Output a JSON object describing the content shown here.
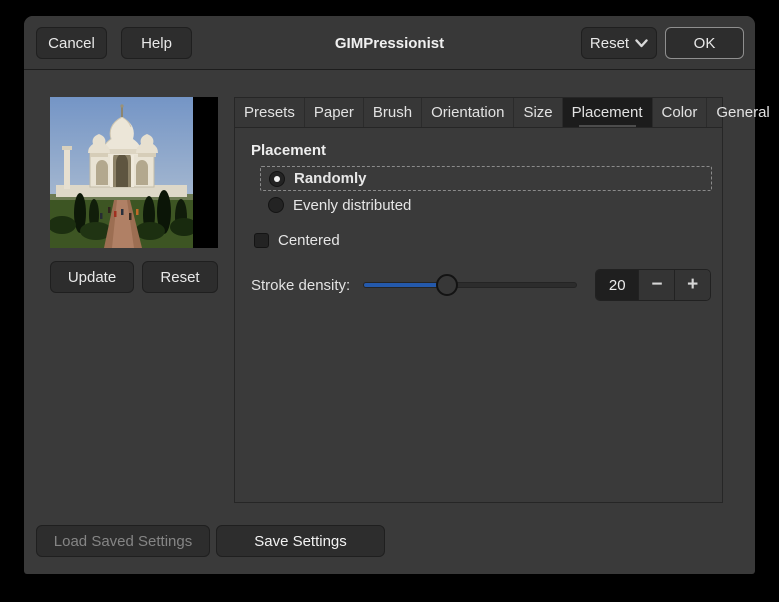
{
  "window": {
    "title": "GIMPressionist"
  },
  "header": {
    "cancel_label": "Cancel",
    "help_label": "Help",
    "reset_label": "Reset",
    "ok_label": "OK"
  },
  "preview": {
    "image_description": "Taj Mahal photograph preview",
    "update_label": "Update",
    "reset_label": "Reset"
  },
  "tabs": [
    {
      "label": "Presets",
      "selected": false
    },
    {
      "label": "Paper",
      "selected": false
    },
    {
      "label": "Brush",
      "selected": false
    },
    {
      "label": "Orientation",
      "selected": false
    },
    {
      "label": "Size",
      "selected": false
    },
    {
      "label": "Placement",
      "selected": true
    },
    {
      "label": "Color",
      "selected": false
    },
    {
      "label": "General",
      "selected": false
    }
  ],
  "placement_panel": {
    "heading": "Placement",
    "radio_options": [
      {
        "label": "Randomly",
        "selected": true
      },
      {
        "label": "Evenly distributed",
        "selected": false
      }
    ],
    "centered_checkbox": {
      "label": "Centered",
      "checked": false
    },
    "stroke_density": {
      "label": "Stroke density:",
      "value": "20",
      "slider_fraction": 0.39,
      "minus_label": "−",
      "plus_label": "+"
    }
  },
  "footer": {
    "load_label": "Load Saved Settings",
    "load_disabled": true,
    "save_label": "Save Settings"
  },
  "colors": {
    "dialog_bg": "#3a3a3a",
    "selected_tab_bg": "#1c1c1c",
    "slider_accent": "#2459ab",
    "entry_bg": "#1f1f1f"
  }
}
